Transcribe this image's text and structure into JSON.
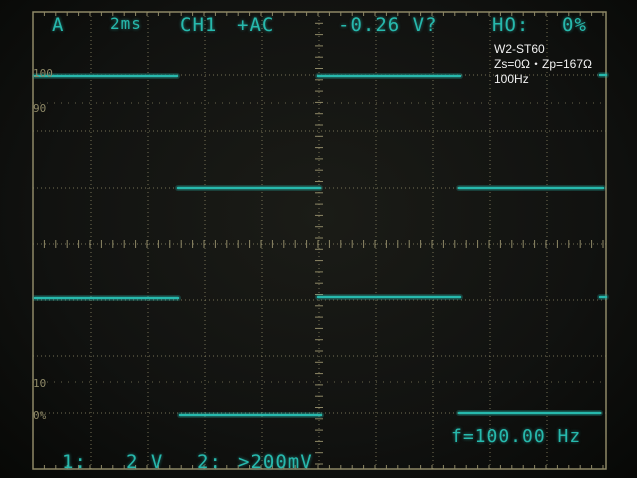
{
  "top_bar": {
    "trigger_mode": "A",
    "timebase": "2ms",
    "channel": "CH1",
    "coupling": "+AC",
    "measurement": "-0.26 V?",
    "hold_label": "HO:",
    "hold_value": "0%"
  },
  "annotation": {
    "line1": "W2-ST60",
    "line2": "Zs=0Ω・Zp=167Ω",
    "line3": "100Hz"
  },
  "scale_labels": {
    "top": "100",
    "top_minor": "90",
    "bottom_minor": "10",
    "bottom": "0%"
  },
  "bottom_bar": {
    "ch1_label": "1:",
    "ch1_scale": "2 V",
    "ch2_label": "2:",
    "ch2_scale": ">200mV",
    "frequency": "f=100.00 Hz"
  },
  "colors": {
    "trace": "#27b9ad",
    "graticule": "#8e8866",
    "background": "#111210"
  }
}
